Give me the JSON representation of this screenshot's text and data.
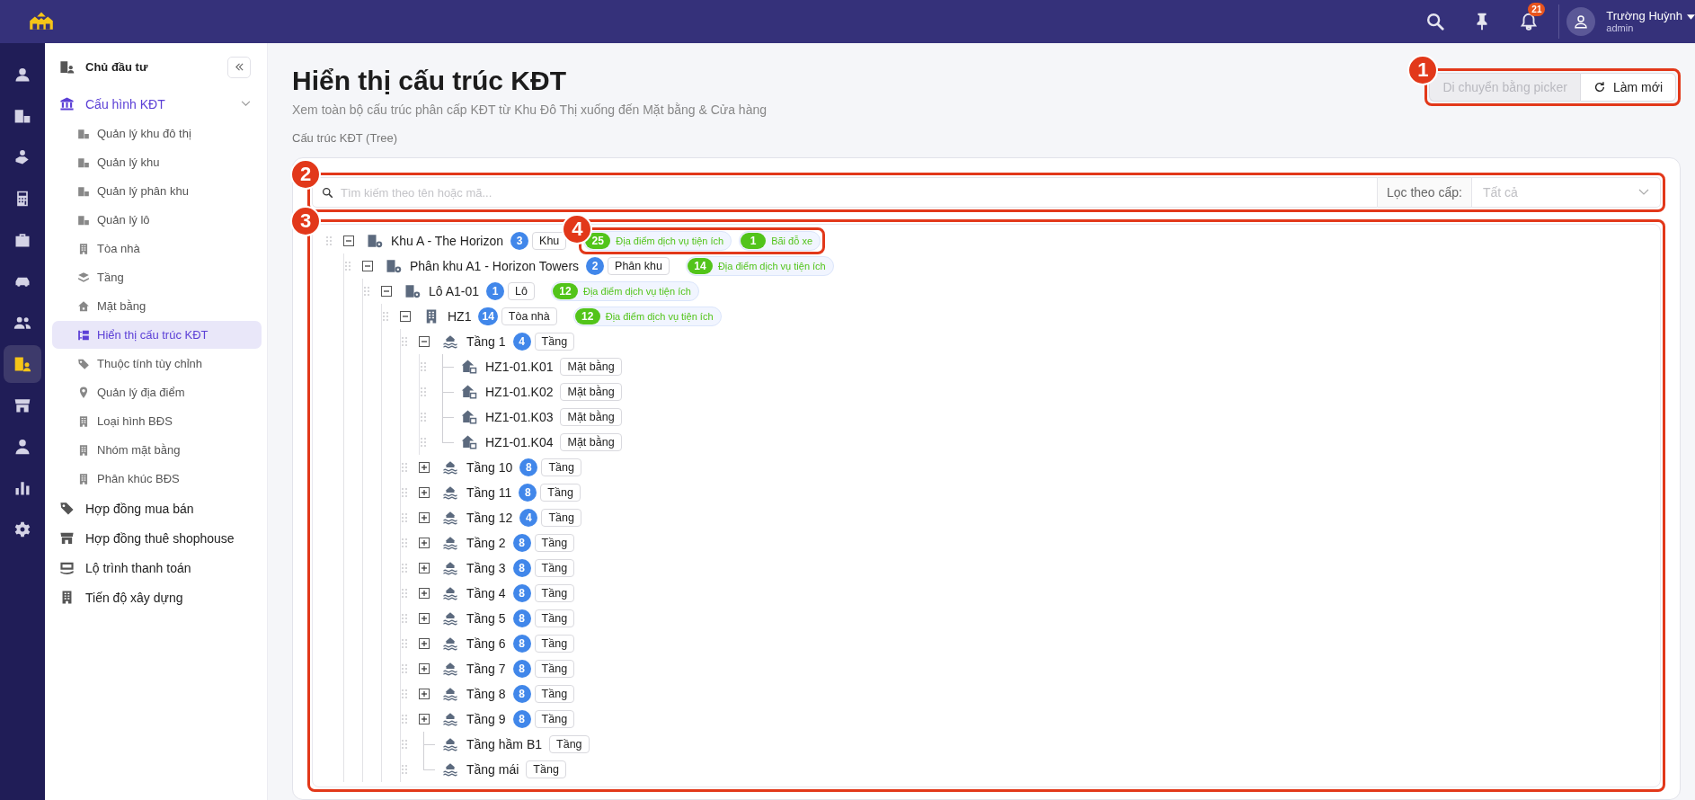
{
  "header": {
    "notifications": "21",
    "user": {
      "name": "Trường Huỳnh",
      "role": "admin"
    }
  },
  "rail": [
    {
      "selected": false
    },
    {
      "selected": false
    },
    {
      "selected": false
    },
    {
      "selected": false
    },
    {
      "selected": false
    },
    {
      "selected": false
    },
    {
      "selected": false
    },
    {
      "selected": true
    },
    {
      "selected": false
    },
    {
      "selected": false
    },
    {
      "selected": false
    },
    {
      "selected": false
    }
  ],
  "sidebar": {
    "items": [
      {
        "label": "Chủ đầu tư",
        "kind": "title",
        "selected": false
      },
      {
        "label": "Cấu hình KĐT",
        "kind": "group",
        "selected": true,
        "expanded": true,
        "children": [
          {
            "label": "Quản lý khu đô thị",
            "selected": false
          },
          {
            "label": "Quản lý khu",
            "selected": false
          },
          {
            "label": "Quản lý phân khu",
            "selected": false
          },
          {
            "label": "Quản lý lô",
            "selected": false
          },
          {
            "label": "Tòa nhà",
            "selected": false
          },
          {
            "label": "Tầng",
            "selected": false
          },
          {
            "label": "Mặt bằng",
            "selected": false
          },
          {
            "label": "Hiển thị cấu trúc KĐT",
            "selected": true
          },
          {
            "label": "Thuộc tính tùy chỉnh",
            "selected": false
          },
          {
            "label": "Quản lý địa điểm",
            "selected": false
          },
          {
            "label": "Loại hình BĐS",
            "selected": false
          },
          {
            "label": "Nhóm mặt bằng",
            "selected": false
          },
          {
            "label": "Phân khúc BĐS",
            "selected": false
          }
        ]
      },
      {
        "label": "Hợp đồng mua bán",
        "kind": "link",
        "selected": false
      },
      {
        "label": "Hợp đồng thuê shophouse",
        "kind": "link",
        "selected": false
      },
      {
        "label": "Lộ trình thanh toán",
        "kind": "link",
        "selected": false
      },
      {
        "label": "Tiến độ xây dựng",
        "kind": "link",
        "selected": false
      }
    ]
  },
  "page": {
    "title": "Hiển thị cấu trúc KĐT",
    "subtitle": "Xem toàn bộ cấu trúc phân cấp KĐT từ Khu Đô Thị xuống đến Mặt bằng & Cửa hàng",
    "section": "Cấu trúc KĐT (Tree)",
    "buttons": [
      {
        "label": "Di chuyển bằng picker",
        "disabled": true
      },
      {
        "label": "Làm mới",
        "disabled": false
      }
    ]
  },
  "search": {
    "placeholder": "Tìm kiếm theo tên hoặc mã...",
    "filter_label": "Lọc theo cấp:",
    "filter_placeholder": "Tất cả"
  },
  "tree": [
    {
      "name": "Khu A - The Horizon",
      "kind": "zone",
      "count": "3",
      "type": "Khu",
      "expanded": true,
      "tags": [
        {
          "count": "25",
          "label": "Địa điểm dịch vụ tiện ích"
        },
        {
          "count": "1",
          "label": "Bãi đỗ xe"
        }
      ],
      "children": [
        {
          "name": "Phân khu A1 - Horizon Towers",
          "kind": "zone",
          "count": "2",
          "type": "Phân khu",
          "expanded": true,
          "tags": [
            {
              "count": "14",
              "label": "Địa điểm dịch vụ tiện ích"
            }
          ],
          "children": [
            {
              "name": "Lô A1-01",
              "kind": "zone",
              "count": "1",
              "type": "Lô",
              "expanded": true,
              "tags": [
                {
                  "count": "12",
                  "label": "Địa điểm dịch vụ tiện ích"
                }
              ],
              "children": [
                {
                  "name": "HZ1",
                  "kind": "building",
                  "count": "14",
                  "type": "Tòa nhà",
                  "expanded": true,
                  "tags": [
                    {
                      "count": "12",
                      "label": "Địa điểm dịch vụ tiện ích"
                    }
                  ],
                  "children": [
                    {
                      "name": "Tầng 1",
                      "kind": "floor",
                      "count": "4",
                      "type": "Tầng",
                      "expanded": true,
                      "children": [
                        {
                          "name": "HZ1-01.K01",
                          "kind": "unit",
                          "type": "Mặt bằng"
                        },
                        {
                          "name": "HZ1-01.K02",
                          "kind": "unit",
                          "type": "Mặt bằng"
                        },
                        {
                          "name": "HZ1-01.K03",
                          "kind": "unit",
                          "type": "Mặt bằng"
                        },
                        {
                          "name": "HZ1-01.K04",
                          "kind": "unit",
                          "type": "Mặt bằng"
                        }
                      ]
                    },
                    {
                      "name": "Tầng 10",
                      "kind": "floor",
                      "count": "8",
                      "type": "Tầng",
                      "expanded": false
                    },
                    {
                      "name": "Tầng 11",
                      "kind": "floor",
                      "count": "8",
                      "type": "Tầng",
                      "expanded": false
                    },
                    {
                      "name": "Tầng 12",
                      "kind": "floor",
                      "count": "4",
                      "type": "Tầng",
                      "expanded": false
                    },
                    {
                      "name": "Tầng 2",
                      "kind": "floor",
                      "count": "8",
                      "type": "Tầng",
                      "expanded": false
                    },
                    {
                      "name": "Tầng 3",
                      "kind": "floor",
                      "count": "8",
                      "type": "Tầng",
                      "expanded": false
                    },
                    {
                      "name": "Tầng 4",
                      "kind": "floor",
                      "count": "8",
                      "type": "Tầng",
                      "expanded": false
                    },
                    {
                      "name": "Tầng 5",
                      "kind": "floor",
                      "count": "8",
                      "type": "Tầng",
                      "expanded": false
                    },
                    {
                      "name": "Tầng 6",
                      "kind": "floor",
                      "count": "8",
                      "type": "Tầng",
                      "expanded": false
                    },
                    {
                      "name": "Tầng 7",
                      "kind": "floor",
                      "count": "8",
                      "type": "Tầng",
                      "expanded": false
                    },
                    {
                      "name": "Tầng 8",
                      "kind": "floor",
                      "count": "8",
                      "type": "Tầng",
                      "expanded": false
                    },
                    {
                      "name": "Tầng 9",
                      "kind": "floor",
                      "count": "8",
                      "type": "Tầng",
                      "expanded": false
                    },
                    {
                      "name": "Tầng hầm B1",
                      "kind": "floor",
                      "type": "Tầng"
                    },
                    {
                      "name": "Tầng mái",
                      "kind": "floor",
                      "type": "Tầng"
                    }
                  ]
                }
              ]
            }
          ]
        }
      ]
    }
  ],
  "annotations": [
    {
      "number": "1"
    },
    {
      "number": "2"
    },
    {
      "number": "3"
    },
    {
      "number": "4"
    }
  ]
}
